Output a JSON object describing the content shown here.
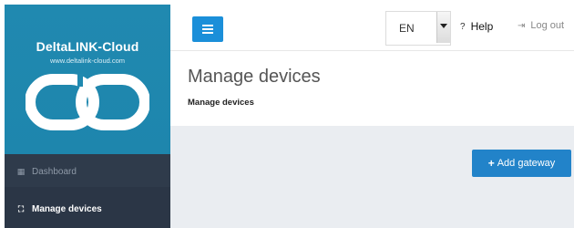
{
  "sidebar": {
    "brand_title": "DeltaLINK-Cloud",
    "brand_url": "www.deltalink-cloud.com",
    "items": [
      {
        "label": "Dashboard",
        "icon": "dashboard-grid-icon"
      },
      {
        "label": "Manage devices",
        "icon": "sitemap-icon"
      }
    ]
  },
  "topbar": {
    "menu_icon": "hamburger-icon",
    "language_value": "EN",
    "help_label": "Help",
    "help_icon_glyph": "?",
    "logout_label": "Log out",
    "logout_icon_glyph": "⇥"
  },
  "page": {
    "title": "Manage devices",
    "subtitle": "Manage devices"
  },
  "content": {
    "add_gateway_label": "Add gateway",
    "add_gateway_icon": "+"
  },
  "colors": {
    "sidebar_bg": "#2f3b4b",
    "brand_bg": "#2089b0",
    "accent_blue": "#1b8fd9",
    "button_blue": "#2283c9",
    "content_bg": "#eaedf1"
  }
}
